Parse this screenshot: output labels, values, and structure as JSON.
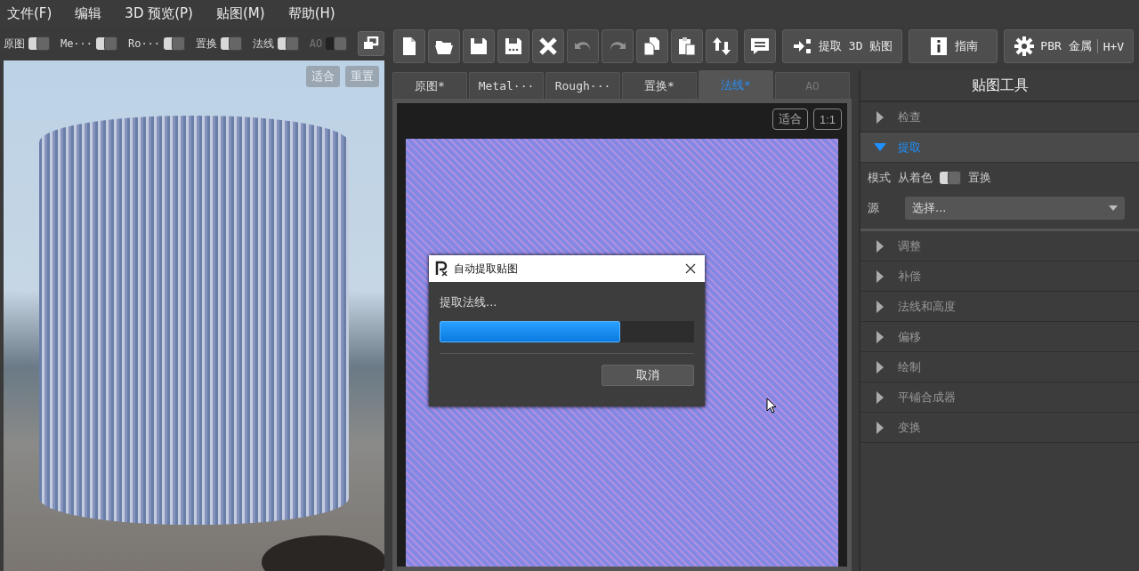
{
  "menu": [
    {
      "label": "文件(F)"
    },
    {
      "label": "编辑"
    },
    {
      "label": "3D 预览(P)"
    },
    {
      "label": "贴图(M)"
    },
    {
      "label": "帮助(H)"
    }
  ],
  "preview_toggles": [
    {
      "label": "原图",
      "on": true,
      "disabled": false
    },
    {
      "label": "Me···",
      "on": true,
      "disabled": false
    },
    {
      "label": "Ro···",
      "on": true,
      "disabled": false
    },
    {
      "label": "置换",
      "on": true,
      "disabled": false
    },
    {
      "label": "法线",
      "on": true,
      "disabled": false
    },
    {
      "label": "AO",
      "on": true,
      "disabled": true
    }
  ],
  "viewport": {
    "buttons": [
      {
        "label": "适合",
        "disabled": true
      },
      {
        "label": "重置",
        "disabled": true
      }
    ]
  },
  "toolbar": [
    {
      "kind": "new",
      "disabled": false
    },
    {
      "kind": "open",
      "disabled": false
    },
    {
      "kind": "save",
      "disabled": false
    },
    {
      "kind": "save-as",
      "disabled": false
    },
    {
      "kind": "close",
      "disabled": false
    },
    {
      "kind": "undo",
      "disabled": true
    },
    {
      "kind": "redo",
      "disabled": true
    },
    {
      "kind": "copy",
      "disabled": false
    },
    {
      "kind": "paste",
      "disabled": false
    },
    {
      "kind": "swap",
      "disabled": false
    },
    {
      "kind": "comment",
      "disabled": false
    },
    {
      "kind": "extract",
      "label": "提取 3D 贴图",
      "disabled": false
    },
    {
      "kind": "info",
      "label": "指南",
      "disabled": false
    },
    {
      "kind": "gear",
      "label": "PBR 金属",
      "suffix": "H+V",
      "disabled": false
    }
  ],
  "tabs": [
    {
      "label": "原图*",
      "selected": false,
      "disabled": false
    },
    {
      "label": "Metal···",
      "selected": false,
      "disabled": false
    },
    {
      "label": "Rough···",
      "selected": false,
      "disabled": false
    },
    {
      "label": "置换*",
      "selected": false,
      "disabled": false
    },
    {
      "label": "法线*",
      "selected": true,
      "disabled": false
    },
    {
      "label": "AO",
      "selected": false,
      "disabled": true
    }
  ],
  "canvas": {
    "buttons": [
      {
        "label": "适合"
      },
      {
        "label": "1:1"
      }
    ]
  },
  "dialog": {
    "title": "自动提取贴图",
    "message": "提取法线...",
    "level": 0.71,
    "cancel": "取消"
  },
  "tools_panel": {
    "title": "贴图工具",
    "sections": [
      {
        "label": "检查",
        "expanded": false
      },
      {
        "label": "提取",
        "expanded": true,
        "mode_label": "模式",
        "mode_left": "从着色",
        "mode_on": true,
        "mode_right": "置换",
        "source_label": "源",
        "source_value": "选择..."
      },
      {
        "label": "调整",
        "expanded": false
      },
      {
        "label": "补偿",
        "expanded": false
      },
      {
        "label": "法线和高度",
        "expanded": false
      },
      {
        "label": "偏移",
        "expanded": false
      },
      {
        "label": "绘制",
        "expanded": false
      },
      {
        "label": "平铺合成器",
        "expanded": false
      },
      {
        "label": "变换",
        "expanded": false
      }
    ]
  }
}
